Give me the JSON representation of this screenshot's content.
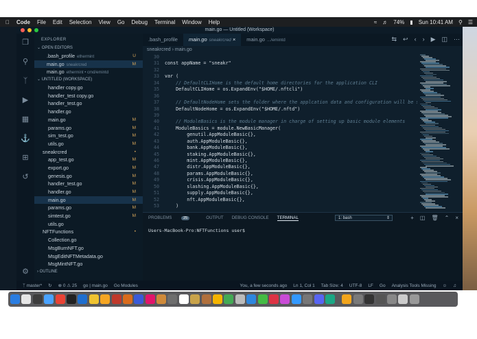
{
  "menubar": {
    "items": [
      "Code",
      "File",
      "Edit",
      "Selection",
      "View",
      "Go",
      "Debug",
      "Terminal",
      "Window",
      "Help"
    ],
    "battery": "74%",
    "clock": "Sun 10:41 AM"
  },
  "window": {
    "title": "main.go — Untitled (Workspace)"
  },
  "sidebar": {
    "header": "EXPLORER",
    "open_editors_label": "OPEN EDITORS",
    "open_editors": [
      {
        "name": ".bash_profile",
        "sub": "ethermint",
        "status": "U"
      },
      {
        "name": "main.go",
        "sub": "sneakrcred",
        "status": "M"
      },
      {
        "name": "main.go",
        "sub": "ethermint • cmd/emintd",
        "status": ""
      }
    ],
    "workspace_label": "UNTITLED (WORKSPACE)",
    "files": [
      {
        "name": "handler copy.go",
        "status": "",
        "indent": 1
      },
      {
        "name": "handler_test copy.go",
        "status": "",
        "indent": 1
      },
      {
        "name": "handler_test.go",
        "status": "",
        "indent": 1
      },
      {
        "name": "handler.go",
        "status": "",
        "indent": 1
      },
      {
        "name": "main.go",
        "status": "M",
        "indent": 1
      },
      {
        "name": "params.go",
        "status": "M",
        "indent": 1
      },
      {
        "name": "sim_test.go",
        "status": "M",
        "indent": 1
      },
      {
        "name": "utils.go",
        "status": "M",
        "indent": 1
      },
      {
        "name": "sneakrcred",
        "status": "•",
        "indent": 0
      },
      {
        "name": "app_test.go",
        "status": "M",
        "indent": 1
      },
      {
        "name": "export.go",
        "status": "M",
        "indent": 1
      },
      {
        "name": "genesis.go",
        "status": "M",
        "indent": 1
      },
      {
        "name": "handler_test.go",
        "status": "M",
        "indent": 1
      },
      {
        "name": "handler.go",
        "status": "M",
        "indent": 1
      },
      {
        "name": "main.go",
        "status": "M",
        "indent": 1
      },
      {
        "name": "params.go",
        "status": "M",
        "indent": 1
      },
      {
        "name": "simtest.go",
        "status": "M",
        "indent": 1
      },
      {
        "name": "utils.go",
        "status": "",
        "indent": 1
      },
      {
        "name": "NFTFunctions",
        "status": "•",
        "indent": 0
      },
      {
        "name": "Collection.go",
        "status": "",
        "indent": 1
      },
      {
        "name": "MsgBurnNFT.go",
        "status": "",
        "indent": 1
      },
      {
        "name": "MsgEditNFTMetadata.go",
        "status": "",
        "indent": 1
      },
      {
        "name": "MsgMintNFT.go",
        "status": "",
        "indent": 1
      }
    ],
    "outline_label": "OUTLINE"
  },
  "tabs": [
    {
      "label": ".bash_profile",
      "sub": ""
    },
    {
      "label": "main.go",
      "sub": "sneakrcred"
    },
    {
      "label": "main.go",
      "sub": ".../emintd"
    }
  ],
  "breadcrumb": [
    "sneakrcred",
    "main.go"
  ],
  "code": [
    {
      "n": "30",
      "t": "",
      "c": false
    },
    {
      "n": "31",
      "t": "const appName = \"sneakr\"",
      "c": false
    },
    {
      "n": "32",
      "t": "",
      "c": false
    },
    {
      "n": "33",
      "t": "var (",
      "c": false
    },
    {
      "n": "34",
      "t": "    // DefaultCLIHome is the default home directories for the application CLI",
      "c": true
    },
    {
      "n": "35",
      "t": "    DefaultCLIHome = os.ExpandEnv(\"$HOME/.nftcli\")",
      "c": false
    },
    {
      "n": "36",
      "t": "",
      "c": false
    },
    {
      "n": "37",
      "t": "    // DefaultNodeHome sets the folder where the applcation data and configuration will be stored",
      "c": true
    },
    {
      "n": "38",
      "t": "    DefaultNodeHome = os.ExpandEnv(\"$HOME/.nftd\")",
      "c": false
    },
    {
      "n": "39",
      "t": "",
      "c": false
    },
    {
      "n": "40",
      "t": "    // ModuleBasics is the module manager in charge of setting up basic module elements",
      "c": true
    },
    {
      "n": "41",
      "t": "    ModuleBasics = module.NewBasicManager(",
      "c": false
    },
    {
      "n": "42",
      "t": "        genutil.AppModuleBasic{},",
      "c": false
    },
    {
      "n": "43",
      "t": "        auth.AppModuleBasic{},",
      "c": false
    },
    {
      "n": "44",
      "t": "        bank.AppModuleBasic{},",
      "c": false
    },
    {
      "n": "45",
      "t": "        staking.AppModuleBasic{},",
      "c": false
    },
    {
      "n": "46",
      "t": "        mint.AppModuleBasic{},",
      "c": false
    },
    {
      "n": "47",
      "t": "        distr.AppModuleBasic{},",
      "c": false
    },
    {
      "n": "48",
      "t": "        params.AppModuleBasic{},",
      "c": false
    },
    {
      "n": "49",
      "t": "        crisis.AppModuleBasic{},",
      "c": false
    },
    {
      "n": "50",
      "t": "        slashing.AppModuleBasic{},",
      "c": false
    },
    {
      "n": "51",
      "t": "        supply.AppModuleBasic{},",
      "c": false
    },
    {
      "n": "52",
      "t": "        nft.AppModuleBasic{},",
      "c": false
    },
    {
      "n": "53",
      "t": "    )",
      "c": false
    }
  ],
  "panel": {
    "tabs": [
      "PROBLEMS",
      "OUTPUT",
      "DEBUG CONSOLE",
      "TERMINAL"
    ],
    "problems_count": "25",
    "active_tab": "TERMINAL",
    "terminal_select": "1: bash",
    "prompt": "Users-MacBook-Pro:NFTFunctions user$"
  },
  "statusbar": {
    "branch": "master*",
    "sync": "",
    "errors": "0",
    "warnings": "25",
    "items": [
      "go | main.go",
      "Go Modules"
    ],
    "right": [
      "You, a few seconds ago",
      "Ln 1, Col 1",
      "Tab Size: 4",
      "UTF-8",
      "LF",
      "Go",
      "Analysis Tools Missing"
    ]
  },
  "colors": {
    "accent": "#d7a65a",
    "editor_bg": "#0f1f2c",
    "sidebar_bg": "#0c1a25",
    "selection": "#17324a"
  }
}
